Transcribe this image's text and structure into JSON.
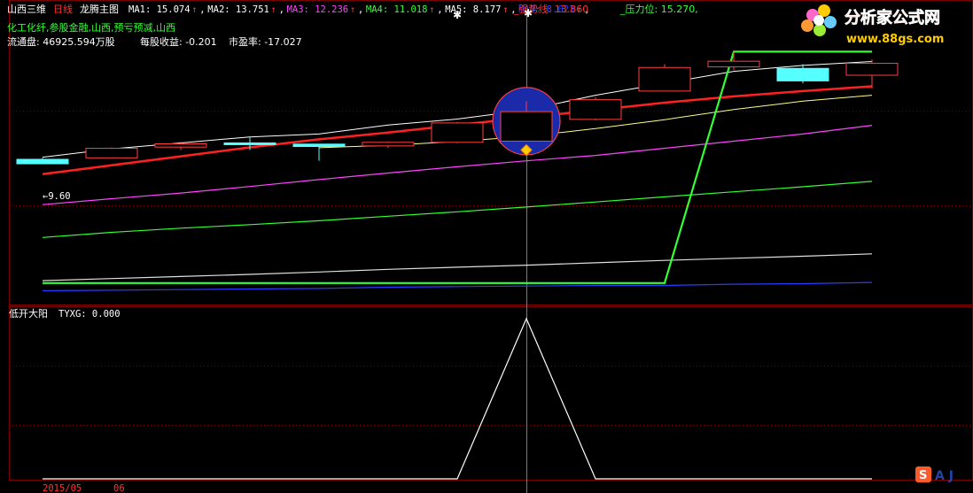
{
  "header": {
    "stock_name": "山西三维",
    "period": "日线",
    "indicator": "龙腾主图",
    "ma": [
      {
        "label": "MA1: 15.074",
        "color": "#ffffff"
      },
      {
        "label": "MA2: 13.751",
        "color": "#ffffff"
      },
      {
        "label": "MA3: 12.236",
        "color": "#ff44ff"
      },
      {
        "label": "MA4: 11.018",
        "color": "#33ff33"
      },
      {
        "label": "MA5: 8.177",
        "color": "#ffffff"
      },
      {
        "label": "MA6: 8.023",
        "color": "#2a3cff"
      }
    ],
    "rise_mark": "↑",
    "strong_line": "_强势线: 13.860",
    "pressure": "_压力位: 15.270,"
  },
  "concepts": "化工化纤,参股金融,山西,预亏预减,山西",
  "float_shares": "流通盘: 46925.594万股",
  "eps": "每股收益: -0.201",
  "pe": "市盈率: -17.027",
  "low_price_label": "←9.60",
  "sub_indicator": {
    "label": "低开大阳",
    "var": "TYXG: 0.000"
  },
  "footer_dates": [
    "2015/05",
    "06"
  ],
  "watermark": {
    "title": "分析家公式网",
    "url": "www.88gs.com"
  },
  "ime_badge": "S",
  "ime_letters": "A J",
  "colors": {
    "grid": "#7a0000",
    "up": "#ff4040",
    "down": "#55ffff",
    "ma1": "#ffffff",
    "ma2": "#ffff88",
    "ma3": "#ff44ff",
    "ma4": "#33ff33",
    "ma5": "#e0e0e0",
    "ma6": "#2a3cff",
    "strong": "#ff2020",
    "green_line": "#33ff33"
  },
  "chart_data": {
    "type": "candlestick",
    "candles": [
      {
        "o": 9.75,
        "c": 9.6,
        "h": 9.8,
        "l": 9.6
      },
      {
        "o": 9.8,
        "c": 10.12,
        "h": 10.15,
        "l": 9.78
      },
      {
        "o": 10.16,
        "c": 10.27,
        "h": 10.34,
        "l": 10.06
      },
      {
        "o": 10.3,
        "c": 10.29,
        "h": 10.48,
        "l": 10.06
      },
      {
        "o": 10.26,
        "c": 10.18,
        "h": 10.26,
        "l": 9.7
      },
      {
        "o": 10.2,
        "c": 10.32,
        "h": 10.35,
        "l": 10.13
      },
      {
        "o": 10.32,
        "c": 10.97,
        "h": 11.0,
        "l": 10.29
      },
      {
        "o": 10.36,
        "c": 11.35,
        "h": 11.7,
        "l": 10.36
      },
      {
        "o": 11.09,
        "c": 11.75,
        "h": 11.84,
        "l": 11.06
      },
      {
        "o": 12.04,
        "c": 12.83,
        "h": 12.94,
        "l": 12.04
      },
      {
        "o": 12.85,
        "c": 13.04,
        "h": 13.36,
        "l": 12.74
      },
      {
        "o": 12.8,
        "c": 12.38,
        "h": 12.94,
        "l": 12.3
      },
      {
        "o": 12.57,
        "c": 12.97,
        "h": 13.1,
        "l": 12.12
      }
    ],
    "ma1": [
      9.82,
      10.1,
      10.3,
      10.5,
      10.6,
      10.9,
      11.1,
      11.4,
      11.9,
      12.3,
      12.7,
      12.9,
      13.03
    ],
    "strong_line": [
      9.25,
      9.55,
      9.85,
      10.15,
      10.42,
      10.65,
      10.9,
      11.15,
      11.4,
      11.65,
      11.86,
      12.04,
      12.2
    ],
    "ma2": [
      null,
      null,
      null,
      null,
      10.14,
      10.22,
      10.35,
      10.52,
      10.78,
      11.08,
      11.42,
      11.7,
      11.9
    ],
    "ma3": [
      8.23,
      8.43,
      8.62,
      8.84,
      9.07,
      9.29,
      9.5,
      9.7,
      9.88,
      10.12,
      10.36,
      10.6,
      10.89
    ],
    "ma4": [
      7.13,
      7.3,
      7.44,
      7.56,
      7.69,
      7.84,
      7.99,
      8.15,
      8.32,
      8.49,
      8.66,
      8.83,
      9.01
    ],
    "ma5": [
      5.68,
      5.75,
      5.82,
      5.89,
      5.97,
      6.06,
      6.13,
      6.2,
      6.28,
      6.36,
      6.43,
      6.5,
      6.58
    ],
    "ma6": [
      5.34,
      5.36,
      5.38,
      5.4,
      5.42,
      5.46,
      5.48,
      5.5,
      5.52,
      5.52,
      5.56,
      5.58,
      5.62
    ],
    "green_line": [
      5.6,
      5.6,
      5.6,
      5.6,
      5.6,
      5.6,
      5.6,
      5.6,
      5.6,
      5.6,
      13.36,
      13.36,
      13.36
    ],
    "tyxg": [
      0,
      0,
      0,
      0,
      0,
      0,
      0,
      1,
      0,
      0,
      0,
      0,
      0
    ],
    "ylim": [
      5.0,
      14.5
    ],
    "signal_index": 7
  }
}
